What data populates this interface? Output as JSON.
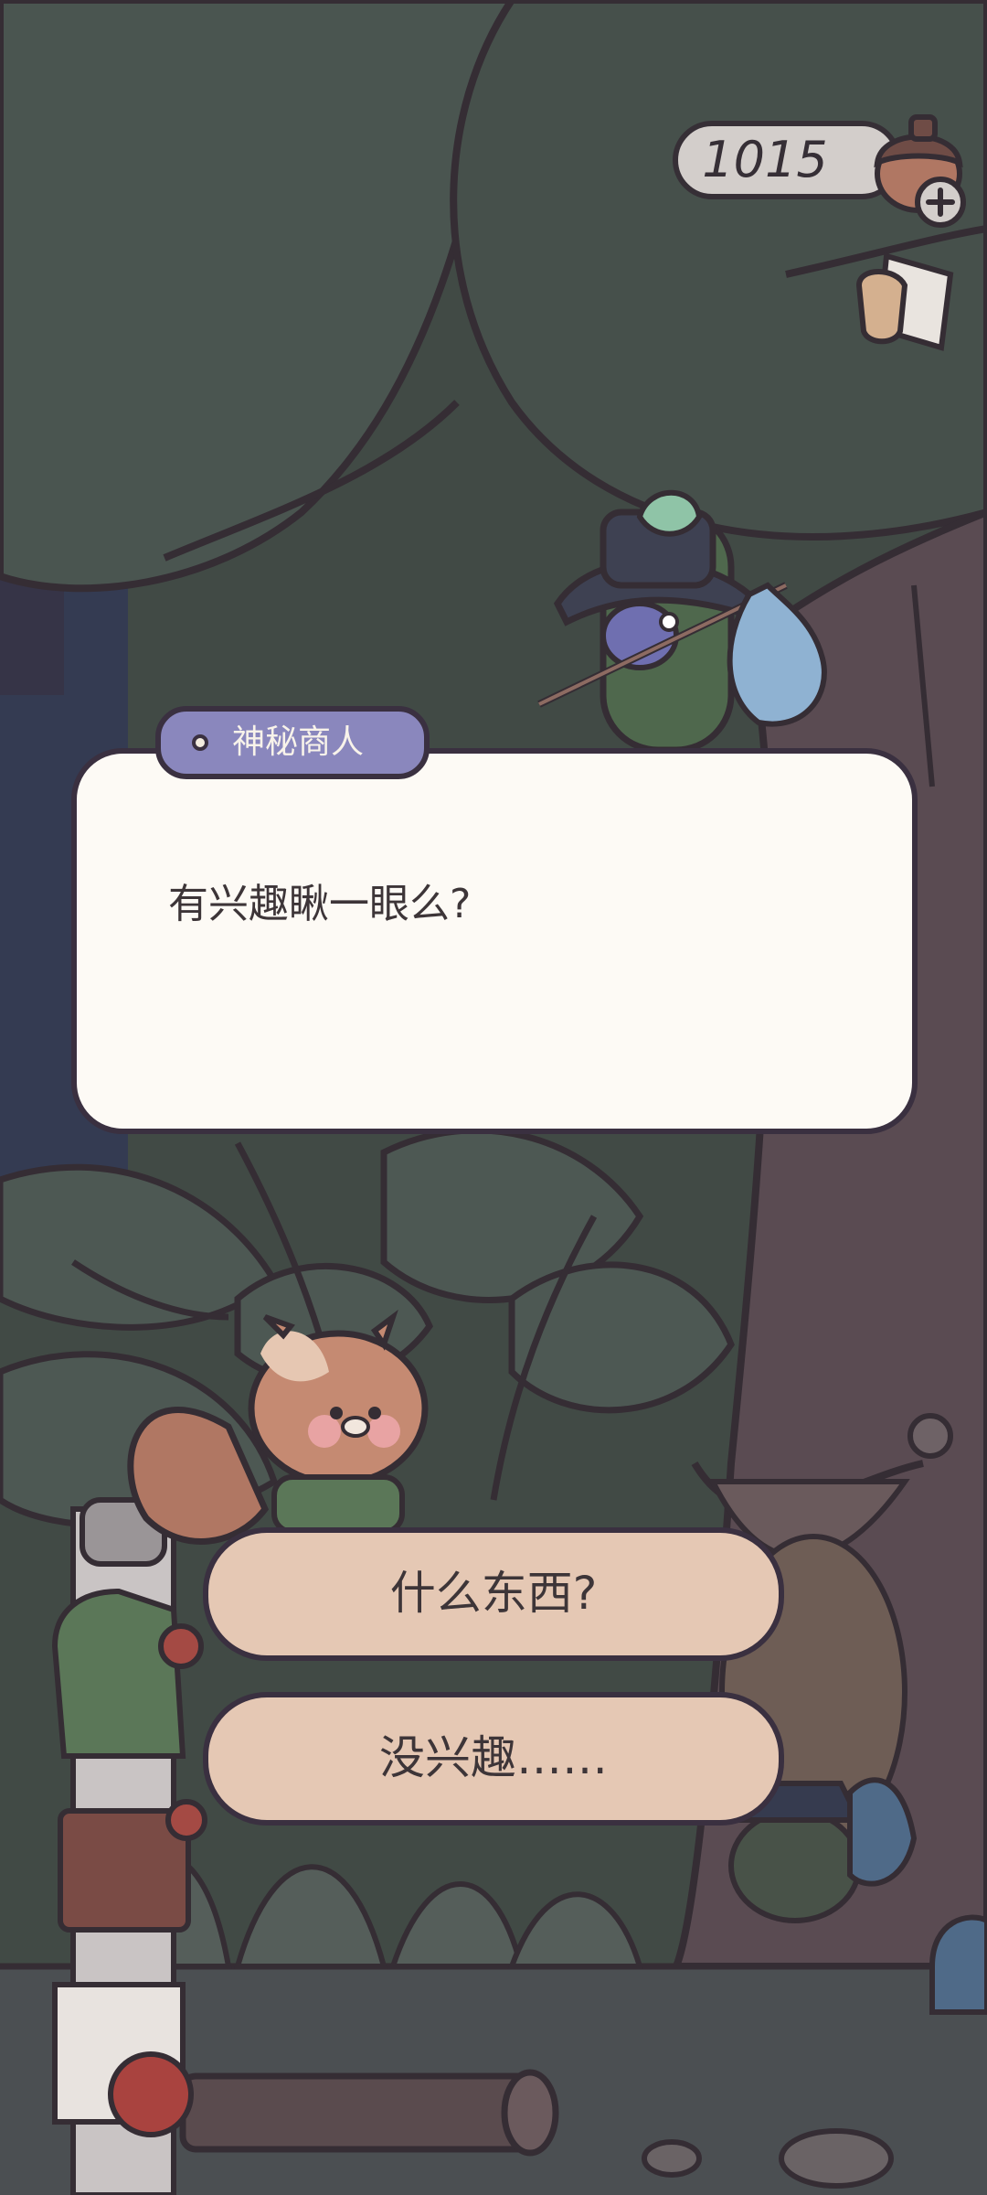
{
  "hud": {
    "coins": "1015",
    "coin_icon": "acorn-icon",
    "add_icon": "plus-icon",
    "menu_icon": "cup-icon"
  },
  "dialog": {
    "speaker": "神秘商人",
    "text": "有兴趣瞅一眼么?"
  },
  "choices": [
    {
      "label": "什么东西?"
    },
    {
      "label": "没兴趣……"
    }
  ],
  "colors": {
    "dialog_bg": "#fdfaf5",
    "name_tag": "#8a87bd",
    "choice_bg": "#e5c8b4",
    "outline": "#3a3040"
  }
}
